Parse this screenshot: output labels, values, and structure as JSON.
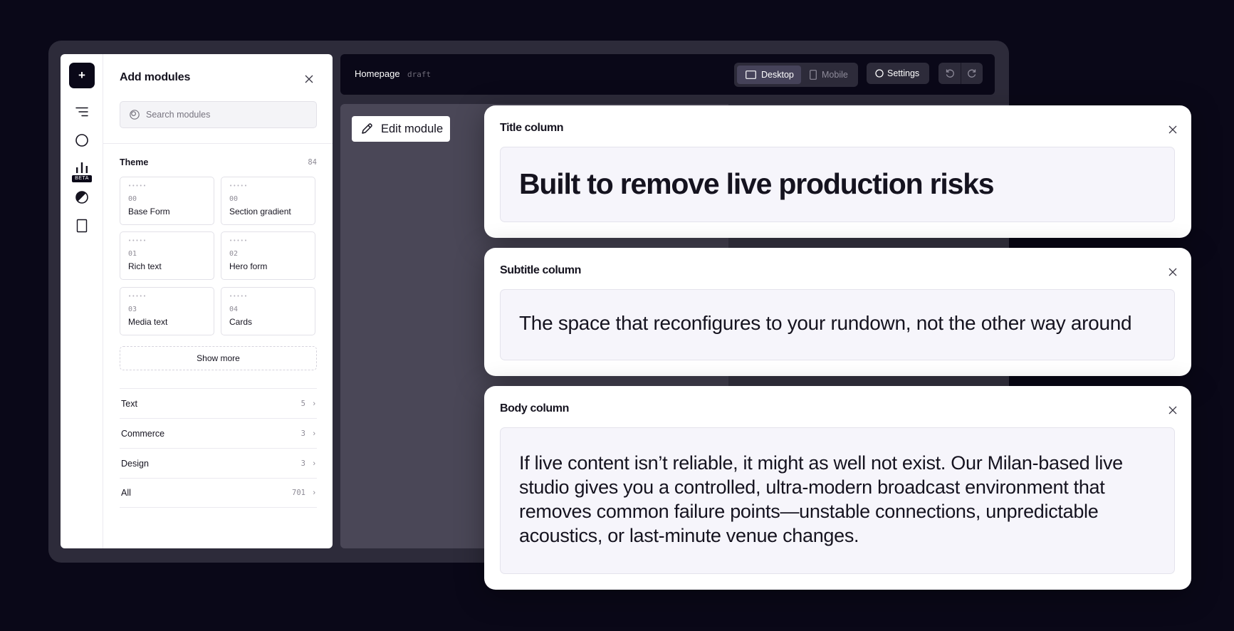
{
  "sidebar": {
    "add_label": "+",
    "beta_label": "BETA"
  },
  "panel": {
    "title": "Add modules",
    "search_placeholder": "Search modules",
    "theme": {
      "label": "Theme",
      "count": "84",
      "modules": [
        {
          "dots": "•••••",
          "num": "00",
          "name": "Base Form"
        },
        {
          "dots": "•••••",
          "num": "00",
          "name": "Section gradient"
        },
        {
          "dots": "•••••",
          "num": "01",
          "name": "Rich text"
        },
        {
          "dots": "•••••",
          "num": "02",
          "name": "Hero form"
        },
        {
          "dots": "•••••",
          "num": "03",
          "name": "Media text"
        },
        {
          "dots": "•••••",
          "num": "04",
          "name": "Cards"
        }
      ],
      "show_more_label": "Show more"
    },
    "categories": [
      {
        "label": "Text",
        "count": "5",
        "chevron": "›"
      },
      {
        "label": "Commerce",
        "count": "3",
        "chevron": "›"
      },
      {
        "label": "Design",
        "count": "3",
        "chevron": "›"
      },
      {
        "label": "All",
        "count": "701",
        "chevron": "›"
      }
    ]
  },
  "topbar": {
    "page_name": "Homepage",
    "page_status": "draft",
    "device_desktop_label": "Desktop",
    "device_mobile_label": "Mobile",
    "settings_label": "Settings"
  },
  "canvas": {
    "edit_module_label": "Edit module"
  },
  "editor_cards": [
    {
      "title": "Title column",
      "value": "Built to remove live production risks"
    },
    {
      "title": "Subtitle column",
      "value": "The space that reconfigures to your rundown, not the other way around"
    },
    {
      "title": "Body column",
      "value": "If live content isn’t reliable, it might as well not exist. Our Milan-based live studio gives you a controlled, ultra-modern broadcast environment that removes common failure points—unstable connections, unpredictable acoustics, or last-minute venue changes."
    }
  ]
}
